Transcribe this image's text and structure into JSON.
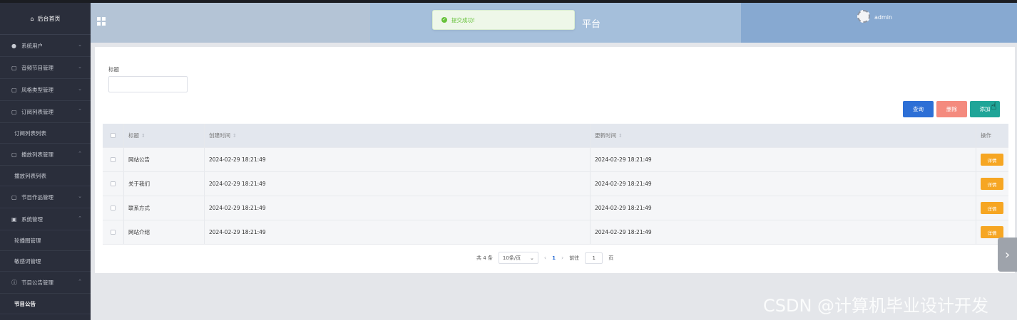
{
  "sidebar": {
    "home": "后台首页",
    "items": [
      {
        "label": "系统用户",
        "icon": "user-icon",
        "chev": "⌄"
      },
      {
        "label": "音频节目管理",
        "icon": "folder-icon",
        "chev": "⌄"
      },
      {
        "label": "风格类型管理",
        "icon": "folder-icon",
        "chev": "⌄"
      },
      {
        "label": "订阅列表管理",
        "icon": "folder-icon",
        "chev": "⌃",
        "sub": "订阅列表列表"
      },
      {
        "label": "播放列表管理",
        "icon": "folder-icon",
        "chev": "⌃",
        "sub": "播放列表列表"
      },
      {
        "label": "节目作品管理",
        "icon": "folder-icon",
        "chev": "⌄"
      },
      {
        "label": "系统管理",
        "icon": "image-icon",
        "chev": "⌃",
        "subs": [
          "轮播图管理",
          "敏感词管理"
        ]
      },
      {
        "label": "节目公告管理",
        "icon": "info-icon",
        "chev": "⌃",
        "sub": "节目公告"
      }
    ]
  },
  "header": {
    "title_fragment": "平台",
    "username": "admin"
  },
  "toast": {
    "text": "提交成功!",
    "color": "#67c23a"
  },
  "filter": {
    "title_label": "标题",
    "title_value": ""
  },
  "actions": {
    "query": "查询",
    "delete": "删除",
    "add": "添加"
  },
  "table": {
    "headers": {
      "title": "标题",
      "created": "创建时间",
      "updated": "更新时间",
      "op": "操作"
    },
    "rows": [
      {
        "title": "网站公告",
        "created": "2024-02-29 18:21:49",
        "updated": "2024-02-29 18:21:49",
        "action": "详情"
      },
      {
        "title": "关于我们",
        "created": "2024-02-29 18:21:49",
        "updated": "2024-02-29 18:21:49",
        "action": "详情"
      },
      {
        "title": "联系方式",
        "created": "2024-02-29 18:21:49",
        "updated": "2024-02-29 18:21:49",
        "action": "详情"
      },
      {
        "title": "网站介绍",
        "created": "2024-02-29 18:21:49",
        "updated": "2024-02-29 18:21:49",
        "action": "详情"
      }
    ]
  },
  "pagination": {
    "total": "共 4 条",
    "page_size": "10条/页",
    "current": "1",
    "goto_label": "前往",
    "goto_value": "1",
    "page_suffix": "页"
  },
  "watermark": "CSDN @计算机毕业设计开发",
  "colors": {
    "sidebar_bg": "#2a2e3b",
    "query": "#2d6fd6",
    "delete": "#f48a7e",
    "add": "#1fa598",
    "detail": "#f6a623"
  }
}
